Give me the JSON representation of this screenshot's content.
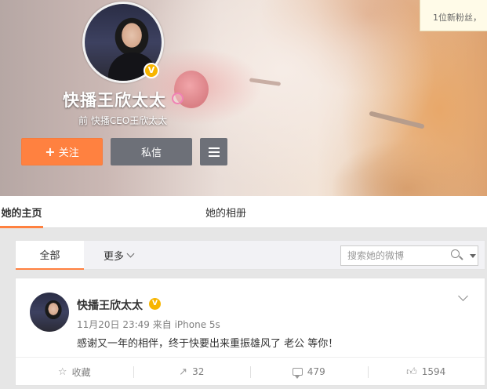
{
  "notice": {
    "text": "1位新粉丝，"
  },
  "profile": {
    "name": "快播王欣太太",
    "description": "前 快播CEO王欣太太",
    "verified_badge": "V",
    "follow_label": "关注",
    "follow_icon": "+",
    "message_label": "私信",
    "gender_icon": "female-icon",
    "accent_color": "#ff8140"
  },
  "tabs": {
    "home": "她的主页",
    "album": "她的相册"
  },
  "filter": {
    "all_label": "全部",
    "more_label": "更多",
    "search_placeholder": "搜索她的微博"
  },
  "post": {
    "author": "快播王欣太太",
    "verified_badge": "V",
    "meta": "11月20日 23:49 来自 iPhone 5s",
    "text": "感谢又一年的相伴，终于快要出来重振雄风了 老公 等你！",
    "actions": {
      "favorite_label": "收藏",
      "forward_count": "32",
      "comment_count": "479",
      "like_count": "1594"
    }
  }
}
